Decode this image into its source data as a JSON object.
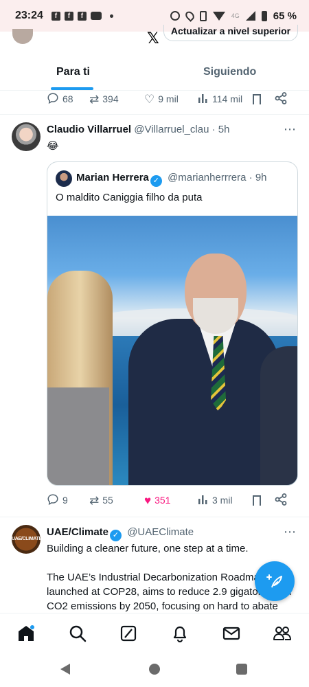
{
  "status_bar": {
    "time": "23:24",
    "network": "4G",
    "battery": "65 %"
  },
  "header": {
    "upgrade_label": "Actualizar a nivel superior"
  },
  "tabs": [
    {
      "label": "Para ti",
      "active": true
    },
    {
      "label": "Siguiendo",
      "active": false
    }
  ],
  "previous_tweet_actions": {
    "replies": "68",
    "retweets": "394",
    "likes": "9 mil",
    "views": "114 mil"
  },
  "tweet1": {
    "name": "Claudio Villarruel",
    "handle": "@Villarruel_clau",
    "time": "· 5h",
    "text": "😂",
    "quote": {
      "name": "Marian Herrera",
      "handle": "@marianherrrera",
      "time": "· 9h",
      "text": "O maldito Caniggia filho da puta"
    },
    "actions": {
      "replies": "9",
      "retweets": "55",
      "likes": "351",
      "views": "3 mil"
    }
  },
  "tweet2": {
    "name": "UAE/Climate",
    "handle": "@UAEClimate",
    "avatar_text": "UAE/CLIMATE",
    "line1": "Building a cleaner future, one step at a time.",
    "paragraph": "The UAE’s Industrial Decarbonization Roadmap, launched at COP28, aims to reduce 2.9 gigatonnes of CO2 emissions by 2050, focusing on hard to abate sectors like cement, steel, aluminum, and iron."
  },
  "colors": {
    "accent": "#1d9bf0",
    "like_active": "#f91880",
    "muted_text": "#536471"
  },
  "icons": {
    "more": "⋯",
    "reply": "◯",
    "retweet": "⇄",
    "like": "♡",
    "liked": "♥",
    "views": "▥",
    "x_logo": "𝕏",
    "verified": "✓"
  }
}
